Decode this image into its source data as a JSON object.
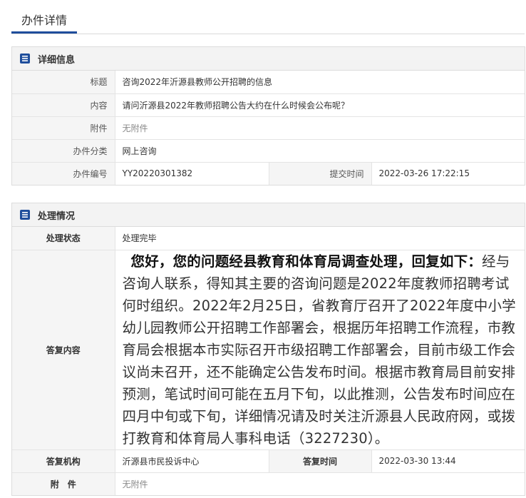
{
  "tab": {
    "label": "办件详情"
  },
  "detail": {
    "heading": "详细信息",
    "rows": {
      "title_label": "标题",
      "title_value": "咨询2022年沂源县教师公开招聘的信息",
      "content_label": "内容",
      "content_value": "请问沂源县2022年教师招聘公告大约在什么时候会公布呢？",
      "attach_label": "附件",
      "attach_value": "无附件",
      "category_label": "办件分类",
      "category_value": "网上咨询",
      "number_label": "办件编号",
      "number_value": "YY20220301382",
      "submit_time_label": "提交时间",
      "submit_time_value": "2022-03-26 17:22:15"
    }
  },
  "handling": {
    "heading": "处理情况",
    "status_label": "处理状态",
    "status_value": "处理完毕",
    "reply_label": "答复内容",
    "reply_lead": "您好，您的问题经县教育和体育局调查处理，回复如下：",
    "reply_body": "经与咨询人联系，得知其主要的咨询问题是2022年度教师招聘考试何时组织。2022年2月25日，省教育厅召开了2022年度中小学幼儿园教师公开招聘工作部署会，根据历年招聘工作流程，市教育局会根据本市实际召开市级招聘工作部署会，目前市级工作会议尚未召开，还不能确定公告发布时间。根据市教育局目前安排预测，笔试时间可能在五月下旬，以此推测，公告发布时间应在四月中旬或下旬，详细情况请及时关注沂源县人民政府网，或拨打教育和体育局人事科电话（3227230）。",
    "org_label": "答复机构",
    "org_value": "沂源县市民投诉中心",
    "reply_time_label": "答复时间",
    "reply_time_value": "2022-03-30 13:44",
    "attach_label": "附　件",
    "attach_value": "无附件"
  },
  "colors": {
    "accent": "#1f4e9c",
    "label_bg": "#f5f5f5",
    "header_bg": "#f3f3f3"
  },
  "icons": {
    "detail_icon": "list-doc-icon",
    "handling_icon": "list-doc-icon"
  }
}
